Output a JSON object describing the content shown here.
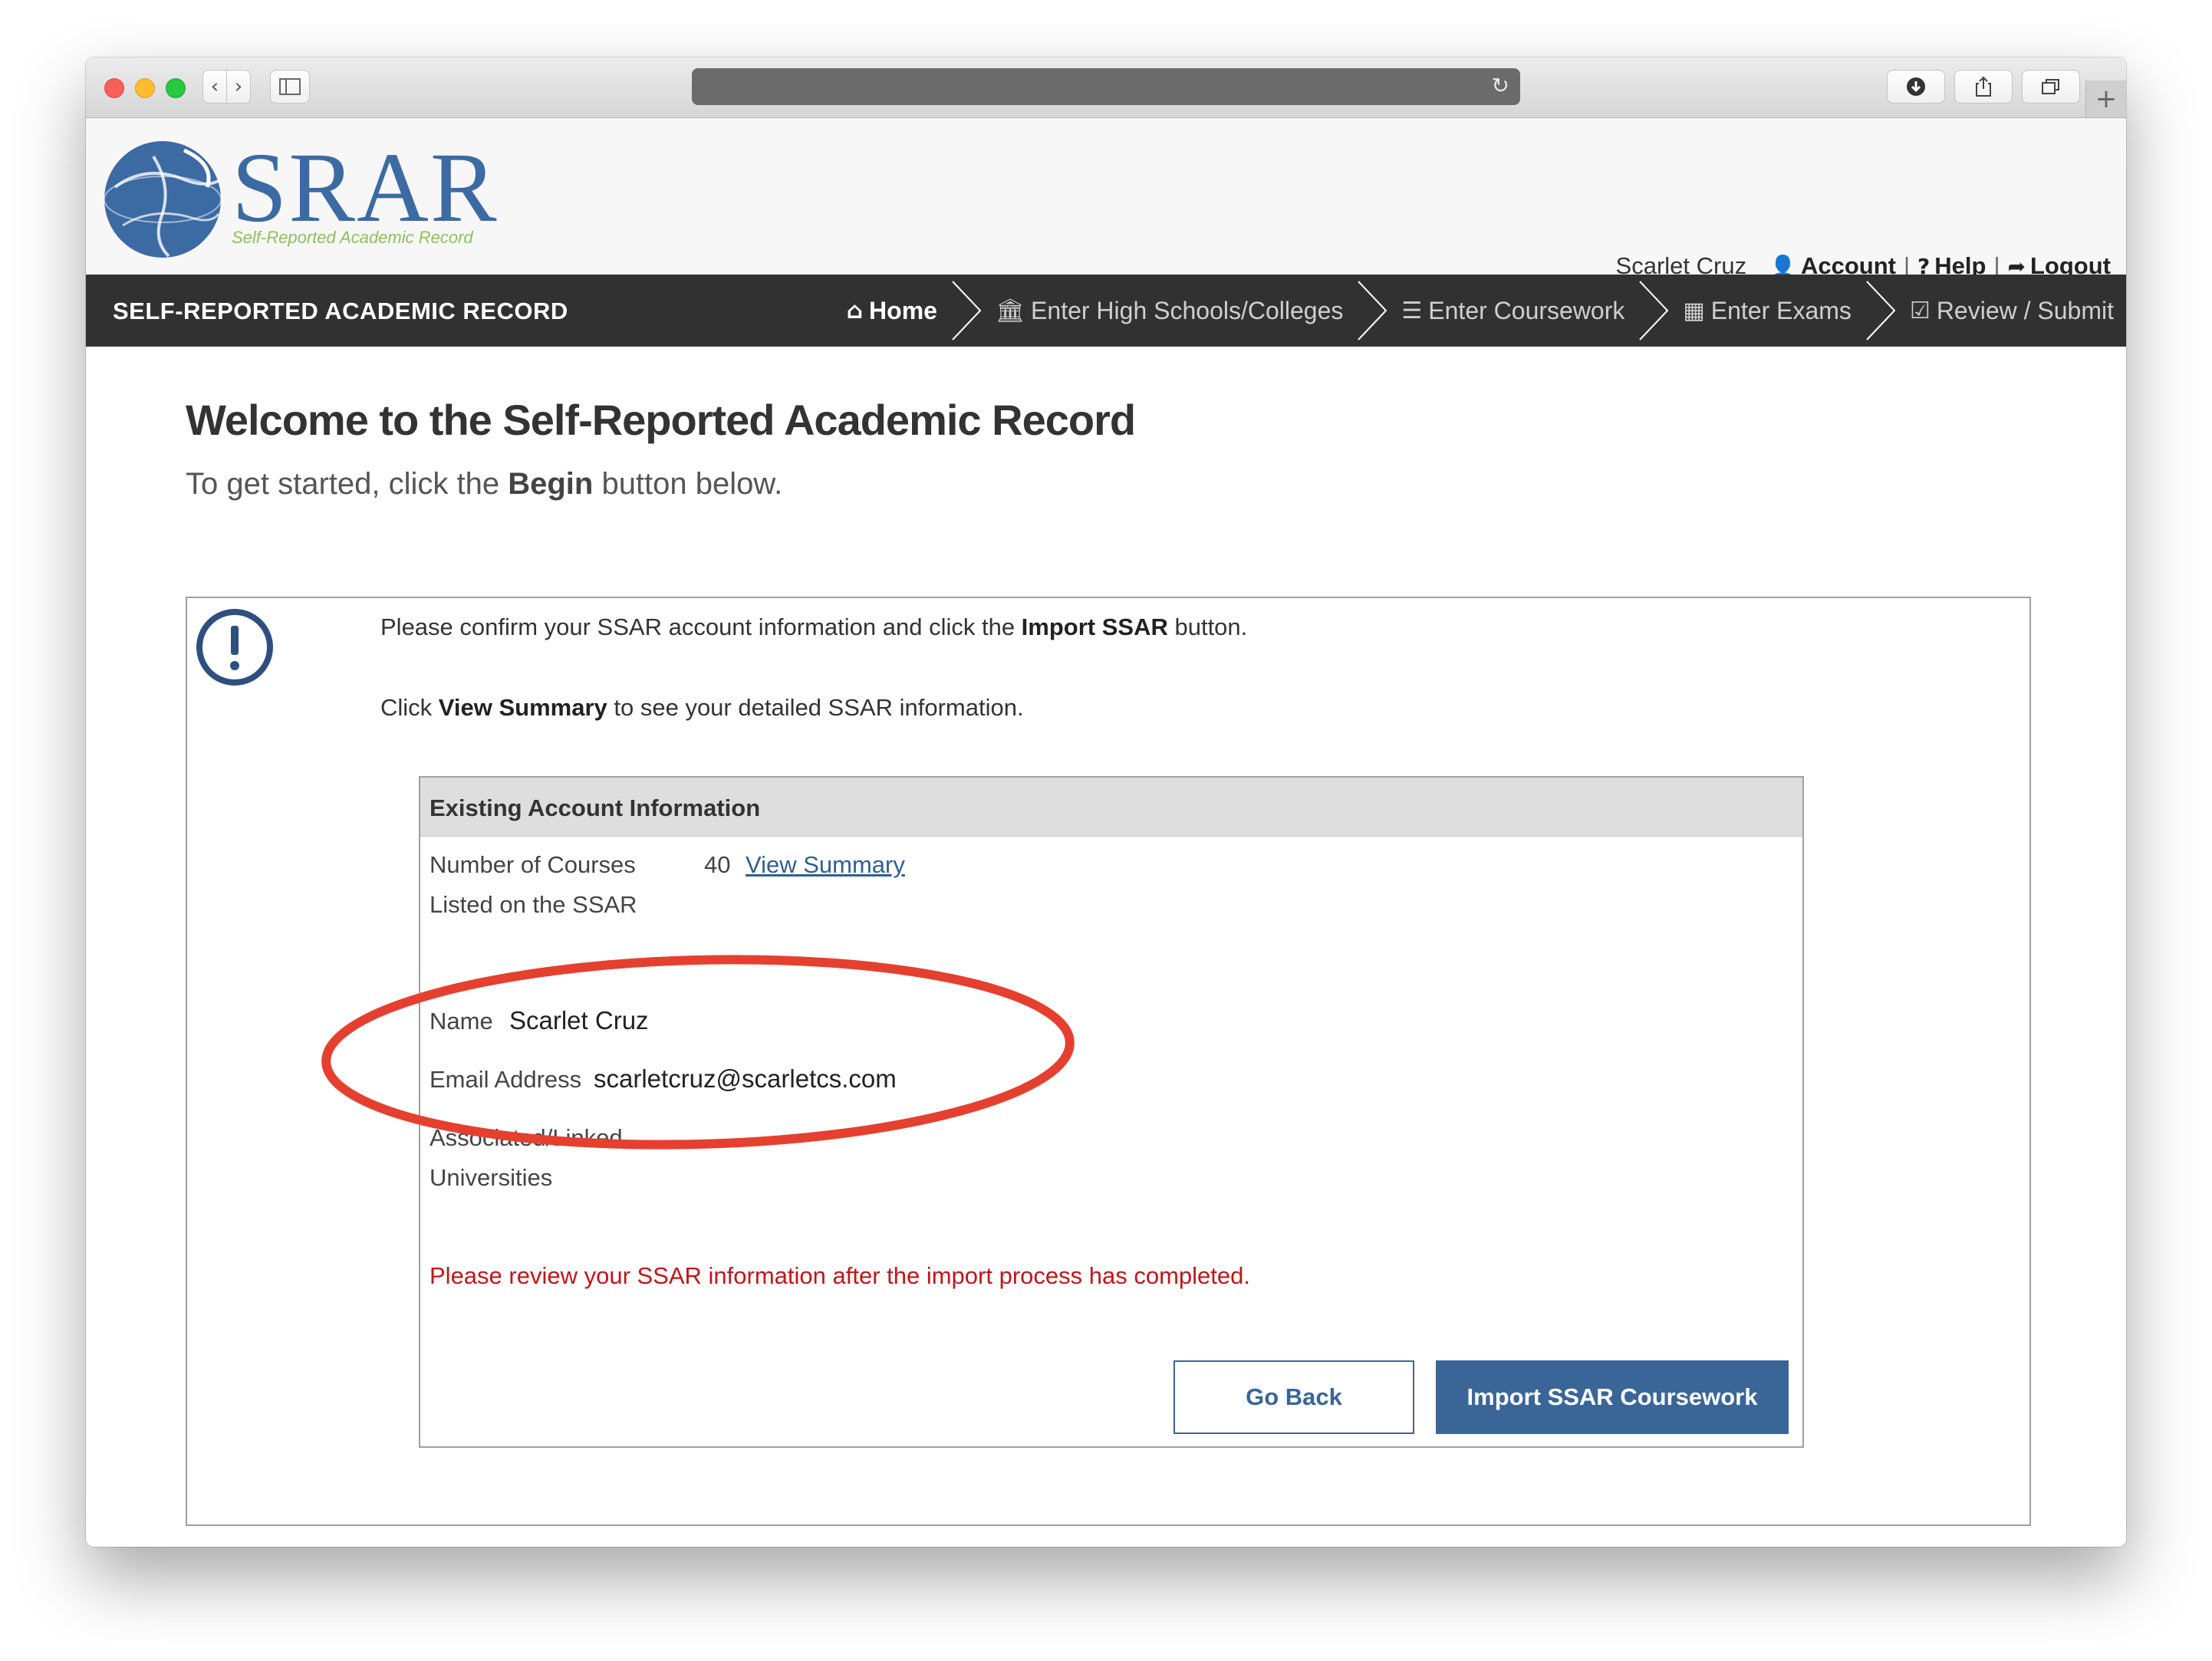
{
  "site": {
    "logo_title": "SRAR",
    "logo_subtitle": "Self-Reported Academic Record",
    "nav_title": "SELF-REPORTED ACADEMIC RECORD",
    "brand_color": "#3c6aa3",
    "accent_color": "#8ebf5c"
  },
  "user_nav": {
    "user_name": "Scarlet Cruz",
    "account_label": "Account",
    "help_label": "Help",
    "logout_label": "Logout",
    "separator": "|"
  },
  "steps": [
    {
      "label": "Home",
      "icon": "home-icon",
      "active": true
    },
    {
      "label": "Enter High Schools/Colleges",
      "icon": "institution-icon",
      "active": false
    },
    {
      "label": "Enter Coursework",
      "icon": "list-icon",
      "active": false
    },
    {
      "label": "Enter Exams",
      "icon": "table-icon",
      "active": false
    },
    {
      "label": "Review / Submit",
      "icon": "check-square-icon",
      "active": false
    }
  ],
  "page": {
    "title": "Welcome to the Self-Reported Academic Record",
    "subtitle_prefix": "To get started, click the ",
    "subtitle_bold": "Begin",
    "subtitle_suffix": " button below."
  },
  "instructions": {
    "line1_prefix": "Please confirm your SSAR account information and click the ",
    "line1_bold": "Import SSAR",
    "line1_suffix": " button.",
    "line2_prefix": "Click ",
    "line2_bold": "View Summary",
    "line2_suffix": " to see your detailed SSAR information."
  },
  "account_info": {
    "heading": "Existing Account Information",
    "courses_label_1": "Number of Courses",
    "courses_label_2": "Listed on the SSAR",
    "courses_count": "40",
    "view_summary_label": "View Summary",
    "name_label": "Name",
    "name_value": "Scarlet Cruz",
    "email_label": "Email Address",
    "email_value": "scarletcruz@scarletcs.com",
    "universities_label_1": "Associated/Linked",
    "universities_label_2": "Universities",
    "warning": "Please review your SSAR information after the import process has completed.",
    "warning_color": "#c0161a"
  },
  "buttons": {
    "go_back": "Go Back",
    "import": "Import SSAR Coursework",
    "primary_color": "#3a6697"
  },
  "annotation": {
    "ellipse_color": "#e5402f"
  }
}
